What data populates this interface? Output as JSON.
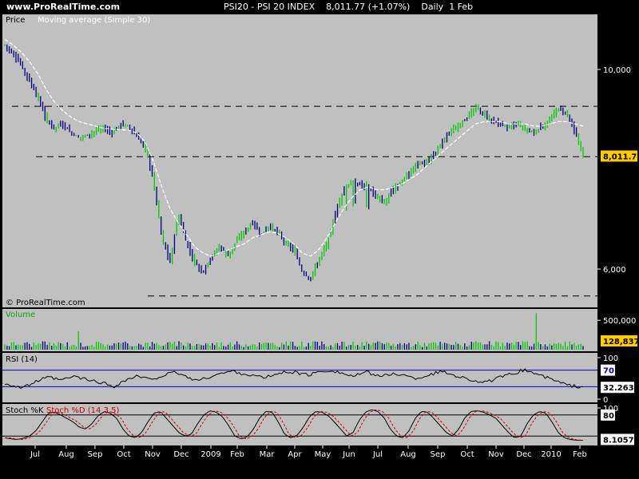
{
  "header": {
    "site": "www.ProRealTime.com",
    "instrument": "PSI20 - PSI 20 INDEX",
    "last": "8,011.77",
    "change": "(+1.07%)",
    "period": "Daily",
    "date": "1 Feb"
  },
  "panels": {
    "price_label": "Price",
    "ma_label": "Moving average (Simple 30)",
    "watermark": "© ProRealTime.com",
    "volume_label": "Volume",
    "rsi_label": "RSI (14)",
    "stoch_label_k": "Stoch %K",
    "stoch_label_d": "Stoch %D (14 3 5)"
  },
  "colors": {
    "panel_bg": "#c0c0c0",
    "up": "#00cc00",
    "down": "#000080",
    "ma": "#ffffff",
    "rsi_line": "#000000",
    "rsi_bands": "#0000cc",
    "stoch_d": "#cc0000",
    "price_tag_bg": "#ffcc00"
  },
  "chart_data": [
    {
      "type": "candlestick",
      "panel": "price",
      "ylim": [
        5700,
        11000
      ],
      "y_ticks": [
        {
          "value": 6000,
          "label": "6,000"
        },
        {
          "value": 10000,
          "label": "10,000"
        }
      ],
      "last_value_label": "8,011.77",
      "horizontal_levels": [
        9100,
        8000,
        5600
      ],
      "x_tick_labels": [
        "Jul",
        "Aug",
        "Sep",
        "Oct",
        "Nov",
        "Dec",
        "2009",
        "Feb",
        "Mar",
        "Apr",
        "May",
        "Jun",
        "Jul",
        "Aug",
        "Sep",
        "Oct",
        "Nov",
        "Dec",
        "2010",
        "Feb"
      ],
      "close_trend": [
        10650,
        10400,
        10100,
        9700,
        9300,
        8800,
        8600,
        8700,
        8500,
        8400,
        8450,
        8550,
        8600,
        8500,
        8700,
        8650,
        8400,
        8200,
        7500,
        6500,
        6100,
        6900,
        6400,
        6100,
        5950,
        6200,
        6350,
        6200,
        6450,
        6600,
        6750,
        6550,
        6700,
        6600,
        6400,
        6300,
        5950,
        5850,
        6150,
        6400,
        6900,
        7350,
        7500,
        7450,
        7400,
        7200,
        7100,
        7350,
        7500,
        7700,
        7850,
        7900,
        8050,
        8300,
        8550,
        8700,
        8850,
        9050,
        8950,
        8750,
        8700,
        8600,
        8700,
        8550,
        8500,
        8650,
        8800,
        9050,
        8900,
        8500,
        8050
      ],
      "ma_trend": [
        10800,
        10650,
        10450,
        10200,
        9900,
        9500,
        9200,
        9000,
        8850,
        8750,
        8700,
        8650,
        8600,
        8580,
        8570,
        8560,
        8500,
        8300,
        7900,
        7400,
        7000,
        6750,
        6550,
        6350,
        6250,
        6200,
        6250,
        6300,
        6350,
        6400,
        6500,
        6550,
        6600,
        6580,
        6500,
        6400,
        6250,
        6200,
        6300,
        6500,
        6750,
        7000,
        7200,
        7350,
        7400,
        7350,
        7350,
        7400,
        7450,
        7550,
        7650,
        7800,
        7950,
        8100,
        8250,
        8400,
        8550,
        8700,
        8750,
        8750,
        8750,
        8700,
        8700,
        8700,
        8650,
        8650,
        8700,
        8750,
        8750,
        8700,
        8650
      ]
    },
    {
      "type": "bar",
      "panel": "volume",
      "ylim": [
        0,
        600000
      ],
      "y_ticks": [
        {
          "value": 500000,
          "label": "500,000"
        }
      ],
      "last_value_label": "128,837",
      "spikes": [
        {
          "index": 33,
          "value": 280000
        },
        {
          "index": 238,
          "value": 560000
        }
      ]
    },
    {
      "type": "line",
      "panel": "rsi",
      "ylim": [
        0,
        100
      ],
      "y_ticks": [
        {
          "value": 100,
          "label": "100"
        },
        {
          "value": 70,
          "label": "70"
        },
        {
          "value": 0,
          "label": "0"
        }
      ],
      "bands": [
        70,
        30
      ],
      "last_value_label": "32.263",
      "values": [
        38,
        35,
        30,
        28,
        32,
        40,
        45,
        50,
        52,
        48,
        46,
        50,
        55,
        52,
        48,
        45,
        42,
        40,
        35,
        30,
        38,
        45,
        50,
        55,
        52,
        48,
        50,
        54,
        58,
        62,
        65,
        58,
        52,
        48,
        45,
        50,
        55,
        60,
        62,
        65,
        68,
        63,
        60,
        58,
        55,
        52,
        54,
        58,
        62,
        65,
        66,
        64,
        60,
        58,
        62,
        66,
        68,
        70,
        66,
        62,
        58,
        55,
        60,
        65,
        62,
        58,
        55,
        58,
        62,
        60,
        56,
        52,
        50,
        54,
        58,
        62,
        66,
        64,
        60,
        56,
        52,
        48,
        45,
        42,
        40,
        45,
        50,
        54,
        58,
        62,
        68,
        70,
        65,
        60,
        55,
        50,
        45,
        40,
        35,
        32,
        30,
        32
      ]
    },
    {
      "type": "line",
      "panel": "stochastic",
      "ylim": [
        0,
        100
      ],
      "y_ticks": [
        {
          "value": 100,
          "label": "100"
        },
        {
          "value": 80,
          "label": "80"
        }
      ],
      "bands": [
        80,
        20
      ],
      "last_value_label": "8.1057",
      "k_values": [
        15,
        12,
        10,
        14,
        20,
        35,
        60,
        85,
        88,
        80,
        70,
        60,
        45,
        40,
        55,
        78,
        90,
        85,
        70,
        40,
        20,
        15,
        30,
        60,
        85,
        90,
        70,
        50,
        30,
        20,
        25,
        55,
        80,
        92,
        88,
        75,
        50,
        20,
        12,
        18,
        40,
        72,
        90,
        88,
        60,
        25,
        15,
        22,
        45,
        75,
        90,
        88,
        78,
        60,
        40,
        20,
        30,
        65,
        88,
        95,
        90,
        72,
        40,
        20,
        15,
        35,
        70,
        90,
        88,
        70,
        50,
        30,
        20,
        40,
        72,
        90,
        92,
        88,
        80,
        70,
        50,
        30,
        15,
        20,
        55,
        80,
        90,
        85,
        60,
        30,
        15,
        10,
        8,
        8
      ]
    }
  ]
}
